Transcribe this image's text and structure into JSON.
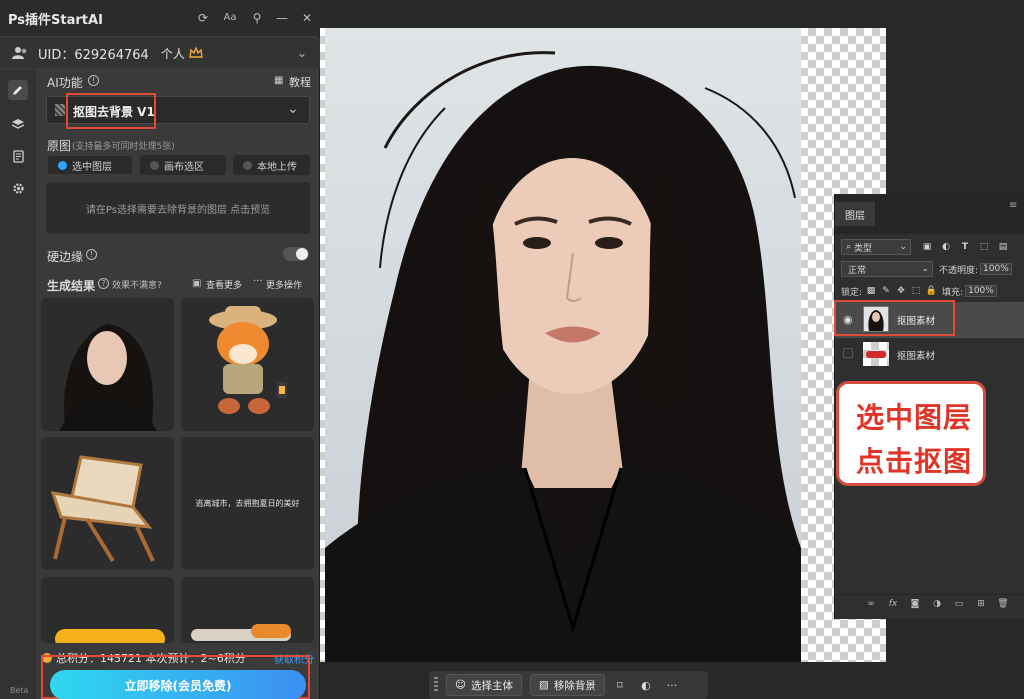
{
  "plugin": {
    "title": "Ps插件StartAI",
    "uid_label": "UID：629264764",
    "plan_label": "个人",
    "ai_function_label": "AI功能",
    "tutorial_label": "教程",
    "model_value": "抠图去背景 V1",
    "source_label": "原图",
    "source_hint": "(支持最多可同时处理5张)",
    "source_options": [
      "选中图层",
      "画布选区",
      "本地上传"
    ],
    "source_selected": "选中图层",
    "instruction": "请在Ps选择需要去除背景的图层 点击预览",
    "hard_edge_label": "硬边缘",
    "hard_edge_on": false,
    "results_label": "生成结果",
    "dissatisfied_label": "效果不满意?",
    "see_more_label": "查看更多",
    "more_actions_label": "更多操作",
    "thumb_text": "逃离城市，去拥抱夏日的美好",
    "points_text": "总积分：145721 本次预计：2~6积分",
    "get_points_label": "获取积分",
    "remove_button": "立即移除(会员免费)",
    "beta_label": "Beta"
  },
  "layers": {
    "tab_label": "图层",
    "filter_label": "类型",
    "blend_mode": "正常",
    "opacity_label": "不透明度:",
    "opacity_value": "100%",
    "lock_label": "锁定:",
    "fill_label": "填充:",
    "fill_value": "100%",
    "items": [
      {
        "name": "抠图素材",
        "visible": true,
        "selected": true
      },
      {
        "name": "抠图素材",
        "visible": false,
        "selected": false
      }
    ]
  },
  "callout": {
    "line1": "选中图层",
    "line2": "点击抠图"
  },
  "context_bar": {
    "select_subject": "选择主体",
    "remove_background": "移除背景"
  },
  "colors": {
    "accent": "#2aa6ff",
    "highlight": "#e04a3a",
    "button_start": "#2fd8ef",
    "button_end": "#3b8ff3"
  }
}
